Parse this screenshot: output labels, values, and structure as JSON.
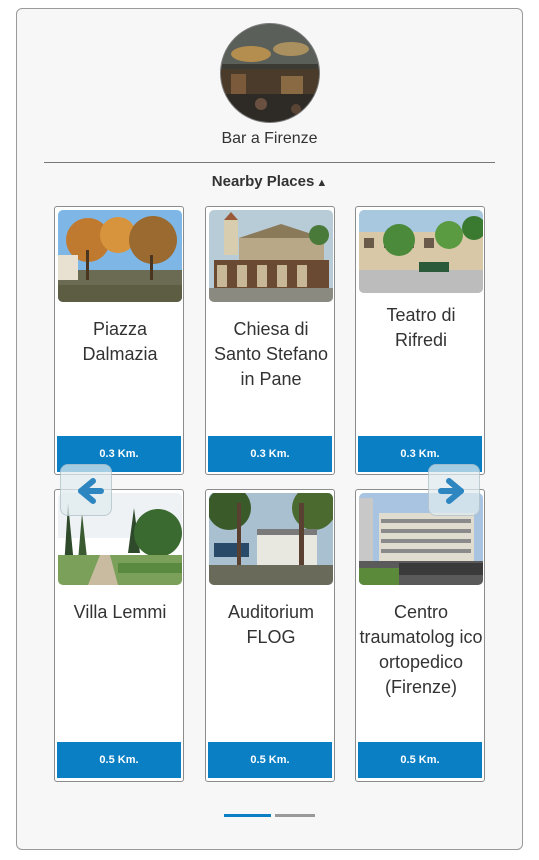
{
  "header": {
    "place_name": "Bar a Firenze",
    "avatar_icon": "bar-photo"
  },
  "nearby": {
    "toggle_label": "Nearby Places",
    "toggle_icon": "caret-up-icon"
  },
  "cards": [
    {
      "title": "Piazza Dalmazia",
      "distance": "0.3 Km."
    },
    {
      "title": "Chiesa di Santo Stefano in Pane",
      "distance": "0.3 Km."
    },
    {
      "title": "Teatro di Rifredi",
      "distance": "0.3 Km."
    },
    {
      "title": "Villa Lemmi",
      "distance": "0.5 Km."
    },
    {
      "title": "Auditorium FLOG",
      "distance": "0.5 Km."
    },
    {
      "title": "Centro traumatolog ico ortopedico (Firenze)",
      "distance": "0.5 Km."
    }
  ],
  "navigation": {
    "prev_icon": "arrow-left-icon",
    "next_icon": "arrow-right-icon"
  },
  "pagination": {
    "pages": 2,
    "active_page": 1
  },
  "colors": {
    "accent": "#0a7fc4",
    "inactive_pager": "#999999",
    "panel_bg": "#f7f7f7"
  }
}
